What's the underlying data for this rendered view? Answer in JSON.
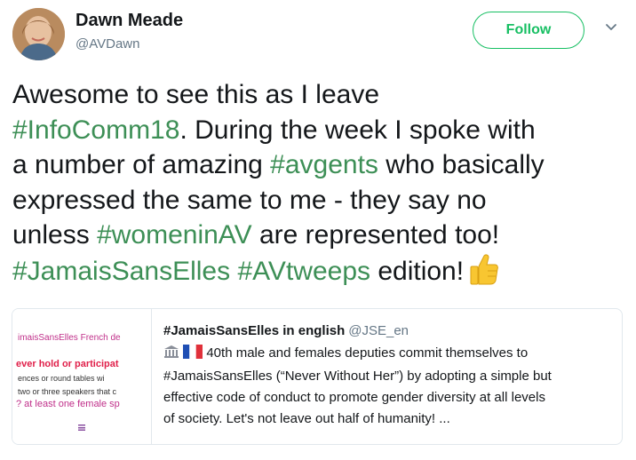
{
  "user": {
    "name": "Dawn Meade",
    "handle": "@AVDawn"
  },
  "actions": {
    "follow_label": "Follow"
  },
  "tweet": {
    "line1": "Awesome to see this as I leave",
    "tag1": "#InfoComm18",
    "line2_rest": ". During the week I spoke with",
    "line3_pre": "a number of amazing ",
    "tag2": "#avgents",
    "line3_post": " who basically",
    "line4": "expressed the same to me - they say no",
    "line5_pre": "unless ",
    "tag3": "#womeninAV",
    "line5_post": " are represented too!",
    "tag4": "#JamaisSansElles",
    "tag5": "#AVtweeps",
    "line6_post": " edition!"
  },
  "quote": {
    "name": "#JamaisSansElles in english",
    "handle": "@JSE_en",
    "text_line1": "40th male and females deputies commit themselves to",
    "text_line2": "#JamaisSansElles (“Never Without Her”) by adopting a simple but",
    "text_line3": "effective code of conduct to promote gender diversity at all levels",
    "text_line4": "of society. Let's not leave out half of humanity! ...",
    "image_lines": [
      "imaisSansElles French de",
      "ever hold or participat",
      "ences or round tables wi",
      "two or three speakers that c",
      "? at least one female sp"
    ]
  },
  "colors": {
    "accent": "#17bf63",
    "hashtag": "#3d8f56",
    "muted": "#657786"
  }
}
